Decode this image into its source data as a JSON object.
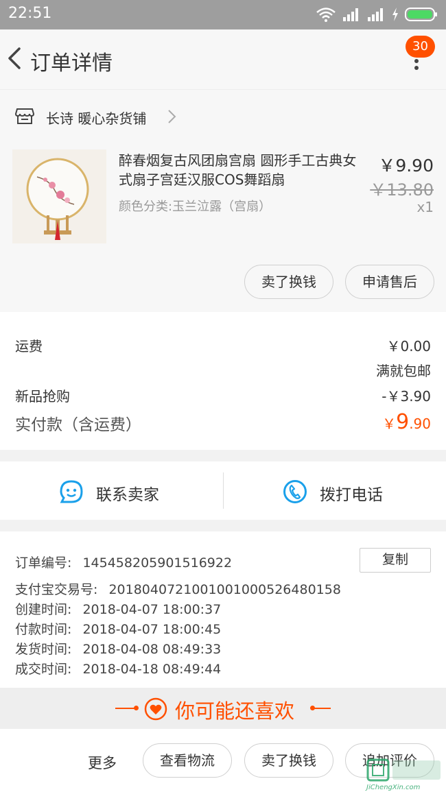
{
  "status_bar": {
    "time": "22:51"
  },
  "header": {
    "title": "订单详情",
    "badge_count": "30"
  },
  "shop": {
    "name": "长诗 暖心杂货铺"
  },
  "product": {
    "title": "醉春烟复古风团扇宫扇 圆形手工古典女式扇子宫廷汉服COS舞蹈扇",
    "variant": "颜色分类:玉兰泣露（宫扇）",
    "price": "￥9.90",
    "original_price": "￥13.80",
    "quantity": "x1",
    "actions": [
      "卖了换钱",
      "申请售后"
    ]
  },
  "fees": {
    "shipping_label": "运费",
    "shipping_value": "￥0.00",
    "shipping_note": "满就包邮",
    "promo_label": "新品抢购",
    "promo_value": "-￥3.90",
    "total_label": "实付款（含运费）",
    "total_currency": "￥",
    "total_int": "9",
    "total_dec": ".90"
  },
  "contact": {
    "seller": "联系卖家",
    "phone": "拨打电话"
  },
  "order_info": {
    "order_no_label": "订单编号:",
    "order_no": "145458205901516922",
    "copy_label": "复制",
    "alipay_label": "支付宝交易号:",
    "alipay_no": "2018040721001001000526480158",
    "created_label": "创建时间:",
    "created": "2018-04-07 18:00:37",
    "paid_label": "付款时间:",
    "paid": "2018-04-07 18:00:45",
    "shipped_label": "发货时间:",
    "shipped": "2018-04-08 08:49:33",
    "completed_label": "成交时间:",
    "completed": "2018-04-18 08:49:44"
  },
  "recommend": {
    "text": "你可能还喜欢"
  },
  "bottom_bar": {
    "more": "更多",
    "logistics": "查看物流",
    "resell": "卖了换钱",
    "review": "追加评价"
  },
  "watermark": {
    "text": "JiChengXin.com"
  },
  "colors": {
    "accent": "#ff5000",
    "contact_icon": "#1aa0ea"
  }
}
